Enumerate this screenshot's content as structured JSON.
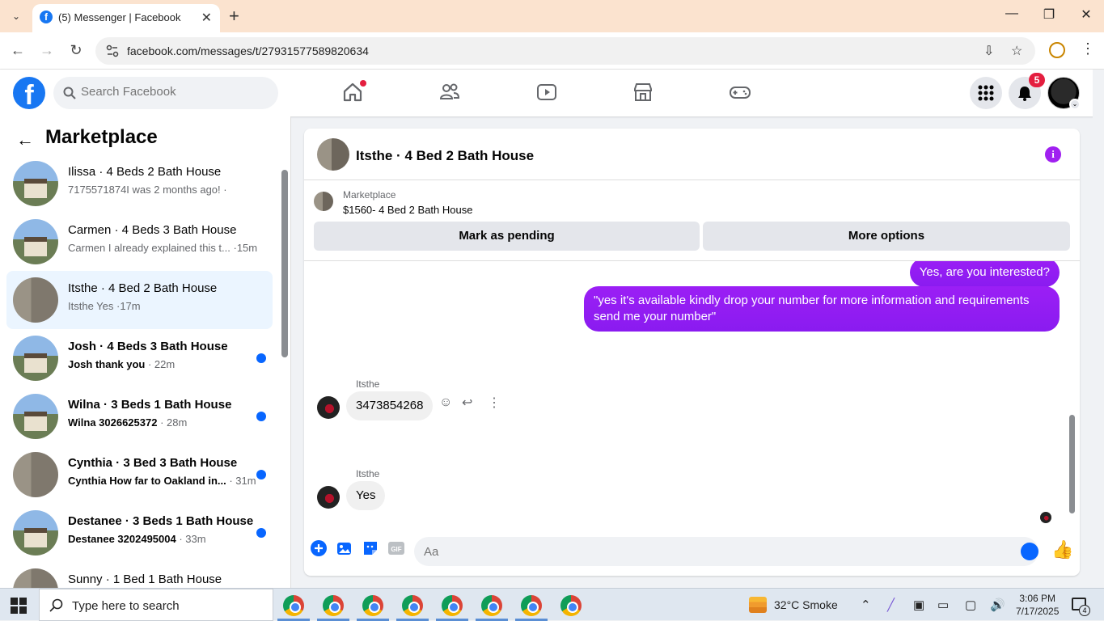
{
  "browser": {
    "tab_title": "(5) Messenger | Facebook",
    "url": "facebook.com/messages/t/27931577589820634"
  },
  "facebook": {
    "search_placeholder": "Search Facebook",
    "notification_count": "5",
    "brand_color": "#1877f2"
  },
  "sidebar": {
    "title": "Marketplace",
    "conversations": [
      {
        "name": "Ilissa · 4 Beds 2 Bath House",
        "preview": "7175571874I was 2 months ago! ·",
        "time": "",
        "unread": false,
        "active": false
      },
      {
        "name": "Carmen · 4 Beds 3 Bath House",
        "preview": "Carmen I already explained this t... ",
        "time": "·15m",
        "unread": false,
        "active": false
      },
      {
        "name": "Itsthe · 4 Bed 2 Bath House",
        "preview": "Itsthe Yes ",
        "time": "·17m",
        "unread": false,
        "active": true
      },
      {
        "name": "Josh · 4 Beds 3 Bath House",
        "preview": "Josh thank you ",
        "time": "· 22m",
        "unread": true,
        "active": false
      },
      {
        "name": "Wilna · 3 Beds 1 Bath House",
        "preview": "Wilna 3026625372 ",
        "time": "· 28m",
        "unread": true,
        "active": false
      },
      {
        "name": "Cynthia · 3 Bed 3 Bath House",
        "preview": "Cynthia How far to Oakland in... ",
        "time": "· 31m",
        "unread": true,
        "active": false
      },
      {
        "name": "Destanee · 3 Beds 1 Bath House",
        "preview": "Destanee 3202495004 ",
        "time": "· 33m",
        "unread": true,
        "active": false
      },
      {
        "name": "Sunny · 1 Bed 1 Bath House",
        "preview": "",
        "time": "",
        "unread": true,
        "active": false
      }
    ]
  },
  "chat": {
    "title": "Itsthe · 4 Bed 2 Bath House",
    "marketplace_label": "Marketplace",
    "listing": "$1560- 4 Bed 2 Bath House",
    "mark_pending_label": "Mark as pending",
    "more_options_label": "More options",
    "messages": {
      "out1": "Yes, are you interested?",
      "out2": "\"yes it's available kindly drop your number for more information and requirements send me your number\"",
      "sender1": "Itsthe",
      "in1": "3473854268",
      "sender2": "Itsthe",
      "in2": "Yes"
    },
    "composer_placeholder": "Aa",
    "accent_color": "#9b1ff5"
  },
  "taskbar": {
    "search_placeholder": "Type here to search",
    "weather": "32°C  Smoke",
    "time": "3:06 PM",
    "date": "7/17/2025",
    "notification_count": "4"
  }
}
